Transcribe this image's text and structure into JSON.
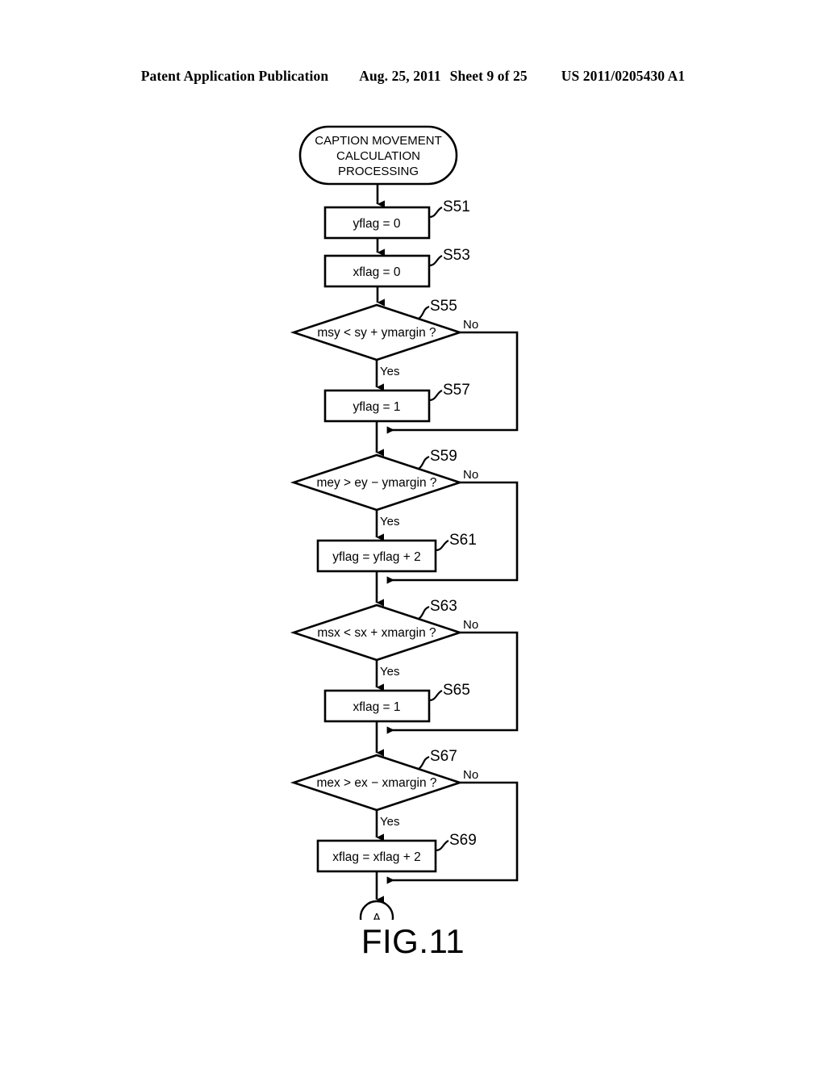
{
  "header": {
    "publication": "Patent Application Publication",
    "date": "Aug. 25, 2011",
    "sheet": "Sheet 9 of 25",
    "document_number": "US 2011/0205430 A1"
  },
  "figure": {
    "caption": "FIG.11"
  },
  "flowchart": {
    "terminator": {
      "line1": "CAPTION MOVEMENT",
      "line2": "CALCULATION",
      "line3": "PROCESSING"
    },
    "connector": {
      "label": "A"
    },
    "branch_labels": {
      "yes": "Yes",
      "no": "No"
    },
    "nodes": [
      {
        "id": "s51",
        "type": "process",
        "step": "S51",
        "text": "yflag = 0"
      },
      {
        "id": "s53",
        "type": "process",
        "step": "S53",
        "text": "xflag = 0"
      },
      {
        "id": "s55",
        "type": "decision",
        "step": "S55",
        "text": "msy < sy + ymargin ?"
      },
      {
        "id": "s57",
        "type": "process",
        "step": "S57",
        "text": "yflag = 1"
      },
      {
        "id": "s59",
        "type": "decision",
        "step": "S59",
        "text": "mey > ey − ymargin ?"
      },
      {
        "id": "s61",
        "type": "process",
        "step": "S61",
        "text": "yflag = yflag + 2"
      },
      {
        "id": "s63",
        "type": "decision",
        "step": "S63",
        "text": "msx < sx + xmargin ?"
      },
      {
        "id": "s65",
        "type": "process",
        "step": "S65",
        "text": "xflag = 1"
      },
      {
        "id": "s67",
        "type": "decision",
        "step": "S67",
        "text": "mex > ex − xmargin ?"
      },
      {
        "id": "s69",
        "type": "process",
        "step": "S69",
        "text": "xflag = xflag + 2"
      }
    ]
  },
  "colors": {
    "ink": "#000000",
    "paper": "#ffffff"
  }
}
